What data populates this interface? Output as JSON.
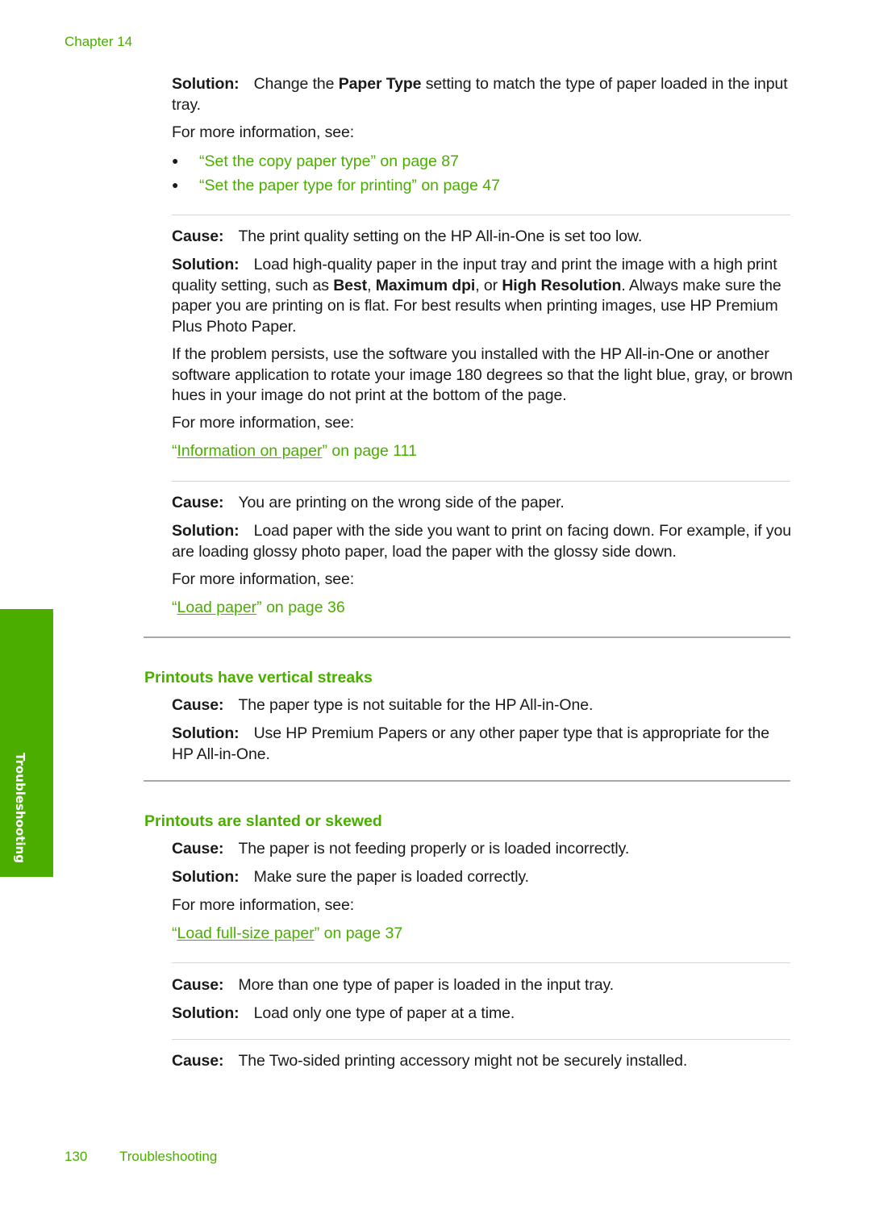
{
  "header": {
    "chapter": "Chapter 14"
  },
  "side_tab": {
    "label": "Troubleshooting",
    "color": "#4aad00"
  },
  "block1": {
    "solution_label": "Solution:",
    "solution_pre": "Change the ",
    "solution_bold": "Paper Type",
    "solution_post": " setting to match the type of paper loaded in the input tray.",
    "more_info": "For more information, see:",
    "links": [
      {
        "open_quote": "“",
        "text": "Set the copy paper type",
        "suffix": "” on page 87"
      },
      {
        "open_quote": "“",
        "text": "Set the paper type for printing",
        "suffix": "” on page 47"
      }
    ]
  },
  "block2": {
    "cause_label": "Cause:",
    "cause_text": "The print quality setting on the HP All-in-One is set too low.",
    "solution_label": "Solution:",
    "solution_parts": [
      "Load high-quality paper in the input tray and print the image with a high print quality setting, such as ",
      "Best",
      ", ",
      "Maximum dpi",
      ", or ",
      "High Resolution",
      ". Always make sure the paper you are printing on is flat. For best results when printing images, use HP Premium Plus Photo Paper."
    ],
    "extra": "If the problem persists, use the software you installed with the HP All-in-One or another software application to rotate your image 180 degrees so that the light blue, gray, or brown hues in your image do not print at the bottom of the page.",
    "more_info": "For more information, see:",
    "link": {
      "open_quote": "“",
      "text": "Information on paper",
      "suffix": "” on page 111"
    }
  },
  "block3": {
    "cause_label": "Cause:",
    "cause_text": "You are printing on the wrong side of the paper.",
    "solution_label": "Solution:",
    "solution_text": "Load paper with the side you want to print on facing down. For example, if you are loading glossy photo paper, load the paper with the glossy side down.",
    "more_info": "For more information, see:",
    "link": {
      "open_quote": "“",
      "text": "Load paper",
      "suffix": "” on page 36"
    }
  },
  "section_streaks": {
    "heading": "Printouts have vertical streaks",
    "cause_label": "Cause:",
    "cause_text": "The paper type is not suitable for the HP All-in-One.",
    "solution_label": "Solution:",
    "solution_text": "Use HP Premium Papers or any other paper type that is appropriate for the HP All-in-One."
  },
  "section_skewed": {
    "heading": "Printouts are slanted or skewed",
    "cause1_label": "Cause:",
    "cause1_text": "The paper is not feeding properly or is loaded incorrectly.",
    "solution1_label": "Solution:",
    "solution1_text": "Make sure the paper is loaded correctly.",
    "more_info": "For more information, see:",
    "link": {
      "open_quote": "“",
      "text": "Load full-size paper",
      "suffix": "” on page 37"
    },
    "cause2_label": "Cause:",
    "cause2_text": "More than one type of paper is loaded in the input tray.",
    "solution2_label": "Solution:",
    "solution2_text": "Load only one type of paper at a time.",
    "cause3_label": "Cause:",
    "cause3_text": "The Two-sided printing accessory might not be securely installed."
  },
  "footer": {
    "page_number": "130",
    "section": "Troubleshooting"
  }
}
